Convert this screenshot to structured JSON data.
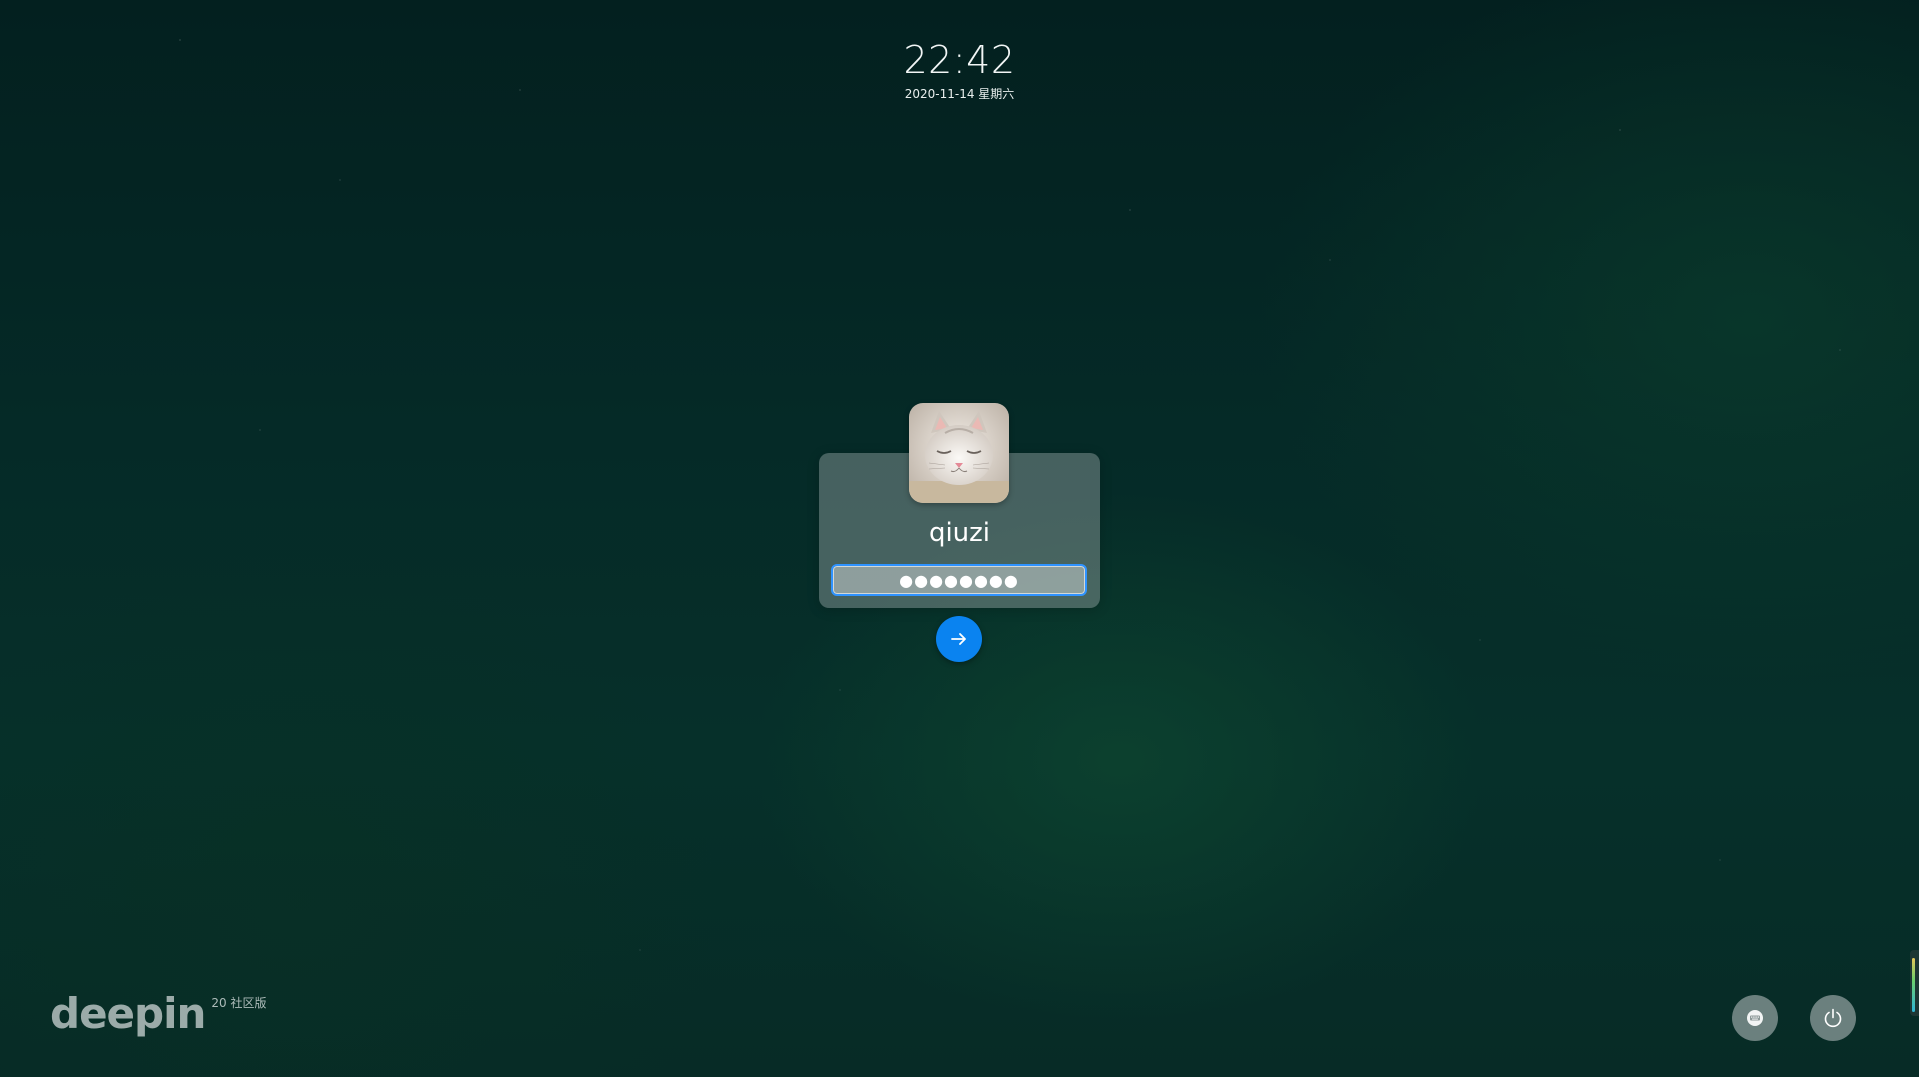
{
  "clock": {
    "time": "22:42",
    "date": "2020-11-14 星期六"
  },
  "user": {
    "name": "qiuzi",
    "avatar_alt": "avatar-cat"
  },
  "password": {
    "value": "●●●●●●●●",
    "focused": true
  },
  "brand": {
    "logo": "deepin",
    "edition": "20 社区版"
  },
  "icons": {
    "submit": "arrow-right-icon",
    "keyboard": "keyboard-icon",
    "power": "power-icon"
  },
  "colors": {
    "accent": "#0a83f0",
    "focus_border": "#2f93ff"
  }
}
